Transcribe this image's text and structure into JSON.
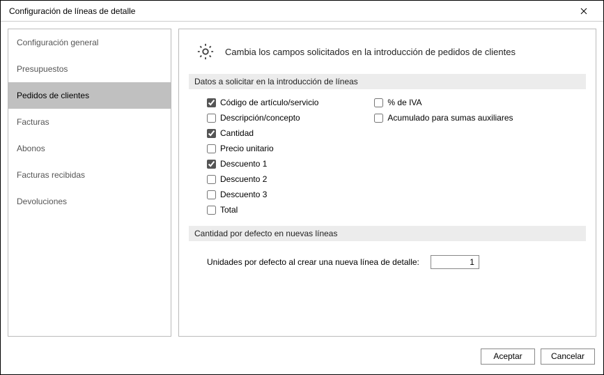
{
  "window": {
    "title": "Configuración de líneas de detalle"
  },
  "sidebar": {
    "items": [
      {
        "label": "Configuración general",
        "selected": false
      },
      {
        "label": "Presupuestos",
        "selected": false
      },
      {
        "label": "Pedidos de clientes",
        "selected": true
      },
      {
        "label": "Facturas",
        "selected": false
      },
      {
        "label": "Abonos",
        "selected": false
      },
      {
        "label": "Facturas recibidas",
        "selected": false
      },
      {
        "label": "Devoluciones",
        "selected": false
      }
    ]
  },
  "main": {
    "header": "Cambia los campos solicitados en la introducción de pedidos de clientes",
    "section1_title": "Datos a solicitar en la introducción de líneas",
    "checks_left": [
      {
        "label": "Código de artículo/servicio",
        "checked": true
      },
      {
        "label": "Descripción/concepto",
        "checked": false
      },
      {
        "label": "Cantidad",
        "checked": true
      },
      {
        "label": "Precio unitario",
        "checked": false
      },
      {
        "label": "Descuento 1",
        "checked": true
      },
      {
        "label": "Descuento 2",
        "checked": false
      },
      {
        "label": "Descuento 3",
        "checked": false
      },
      {
        "label": "Total",
        "checked": false
      }
    ],
    "checks_right": [
      {
        "label": "% de IVA",
        "checked": false
      },
      {
        "label": "Acumulado para sumas auxiliares",
        "checked": false
      }
    ],
    "section2_title": "Cantidad por defecto en nuevas líneas",
    "qty_label": "Unidades por defecto al crear una nueva línea de detalle:",
    "qty_value": "1"
  },
  "footer": {
    "accept": "Aceptar",
    "cancel": "Cancelar"
  }
}
